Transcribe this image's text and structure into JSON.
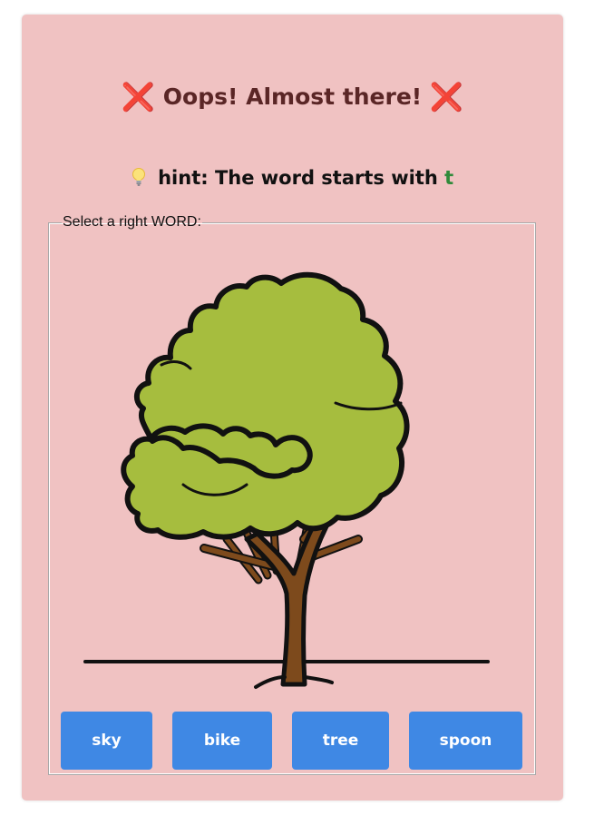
{
  "feedback": {
    "title": "Oops! Almost there!",
    "icon_left": "❌",
    "icon_right": "❌"
  },
  "hint": {
    "icon": "light-bulb-icon",
    "text": "hint: The word starts with",
    "letter": "t"
  },
  "question": {
    "legend": "Select a right WORD:",
    "image": "tree-illustration"
  },
  "options": [
    {
      "label": "sky"
    },
    {
      "label": "bike"
    },
    {
      "label": "tree"
    },
    {
      "label": "spoon"
    }
  ],
  "colors": {
    "card_bg": "#f0c2c2",
    "button_bg": "#3f88e4",
    "title_text": "#5a2626",
    "cross_icon": "#e0405a",
    "hint_letter": "#2f8a3a",
    "foliage": "#a6bd3e",
    "trunk": "#7d4a1c"
  }
}
